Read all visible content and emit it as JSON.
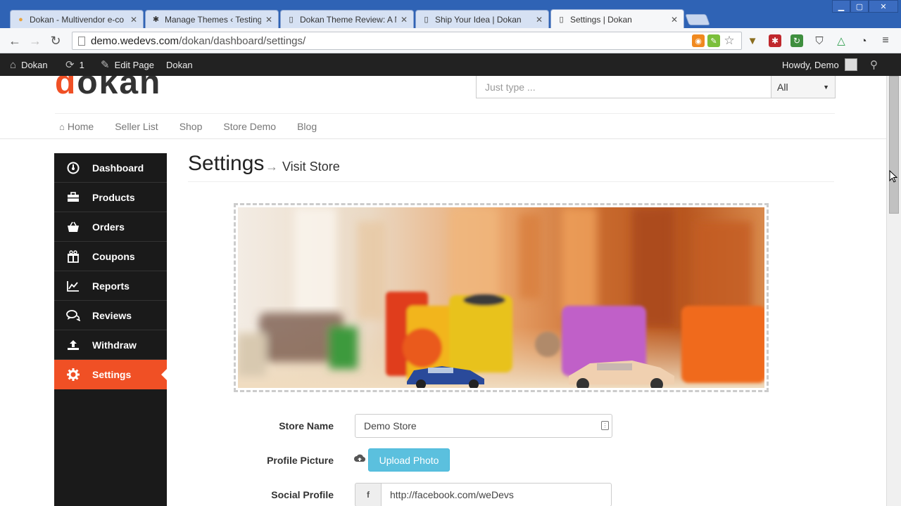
{
  "browser": {
    "tabs": [
      {
        "title": "Dokan - Multivendor e-co",
        "active": false
      },
      {
        "title": "Manage Themes ‹ Testing",
        "active": false
      },
      {
        "title": "Dokan Theme Review: A N",
        "active": false
      },
      {
        "title": "Ship Your Idea | Dokan",
        "active": false
      },
      {
        "title": "Settings | Dokan",
        "active": true
      }
    ],
    "url_host": "demo.wedevs.com",
    "url_path": "/dokan/dashboard/settings/"
  },
  "adminbar": {
    "site": "Dokan",
    "updates": "1",
    "edit_page": "Edit Page",
    "dokan": "Dokan",
    "howdy": "Howdy, Demo"
  },
  "header": {
    "logo_accent": "d",
    "logo_rest": "okan",
    "search_placeholder": "Just type ...",
    "search_category": "All",
    "nav": [
      "Home",
      "Seller List",
      "Shop",
      "Store Demo",
      "Blog"
    ]
  },
  "sidebar": {
    "items": [
      {
        "label": "Dashboard",
        "icon": "dashboard-icon",
        "active": false
      },
      {
        "label": "Products",
        "icon": "briefcase-icon",
        "active": false
      },
      {
        "label": "Orders",
        "icon": "basket-icon",
        "active": false
      },
      {
        "label": "Coupons",
        "icon": "gift-icon",
        "active": false
      },
      {
        "label": "Reports",
        "icon": "chart-icon",
        "active": false
      },
      {
        "label": "Reviews",
        "icon": "comments-icon",
        "active": false
      },
      {
        "label": "Withdraw",
        "icon": "upload-icon",
        "active": false
      },
      {
        "label": "Settings",
        "icon": "cog-icon",
        "active": true
      }
    ]
  },
  "main": {
    "title": "Settings",
    "visit_arrow": "→",
    "visit_store": "Visit Store",
    "form": {
      "store_name_label": "Store Name",
      "store_name_value": "Demo Store",
      "profile_picture_label": "Profile Picture",
      "upload_button": "Upload Photo",
      "social_profile_label": "Social Profile",
      "facebook_value": "http://facebook.com/weDevs"
    }
  },
  "colors": {
    "accent": "#f05025",
    "sidebar_bg": "#1a1a1a",
    "info_button": "#5bc0de"
  }
}
